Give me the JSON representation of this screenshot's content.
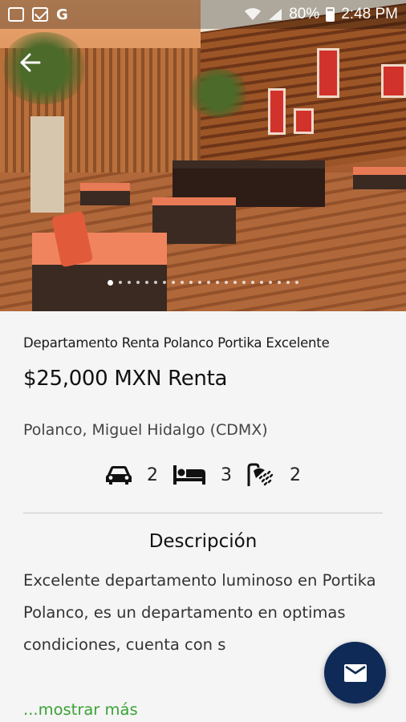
{
  "status_bar": {
    "battery": "80%",
    "time": "2:48 PM",
    "icons": [
      "image-icon",
      "gmail-icon",
      "google-icon",
      "wifi-icon",
      "signal-icon",
      "battery-icon"
    ],
    "g_glyph": "G"
  },
  "gallery": {
    "total_images": 22,
    "current_index": 0
  },
  "listing": {
    "title": "Departamento Renta Polanco Portika Excelente",
    "price": "$25,000 MXN Renta",
    "location": "Polanco, Miguel Hidalgo (CDMX)",
    "features": [
      {
        "icon": "car-icon",
        "value": "2"
      },
      {
        "icon": "bed-icon",
        "value": "3"
      },
      {
        "icon": "shower-icon",
        "value": "2"
      }
    ]
  },
  "description": {
    "heading": "Descripción",
    "text": "Excelente departamento luminoso en Portika Polanco, es un departamento en optimas condiciones, cuenta con s",
    "more_label": "...mostrar más"
  },
  "colors": {
    "fab": "#0f2a57",
    "link": "#3aa335",
    "background": "#f5f5f5"
  }
}
